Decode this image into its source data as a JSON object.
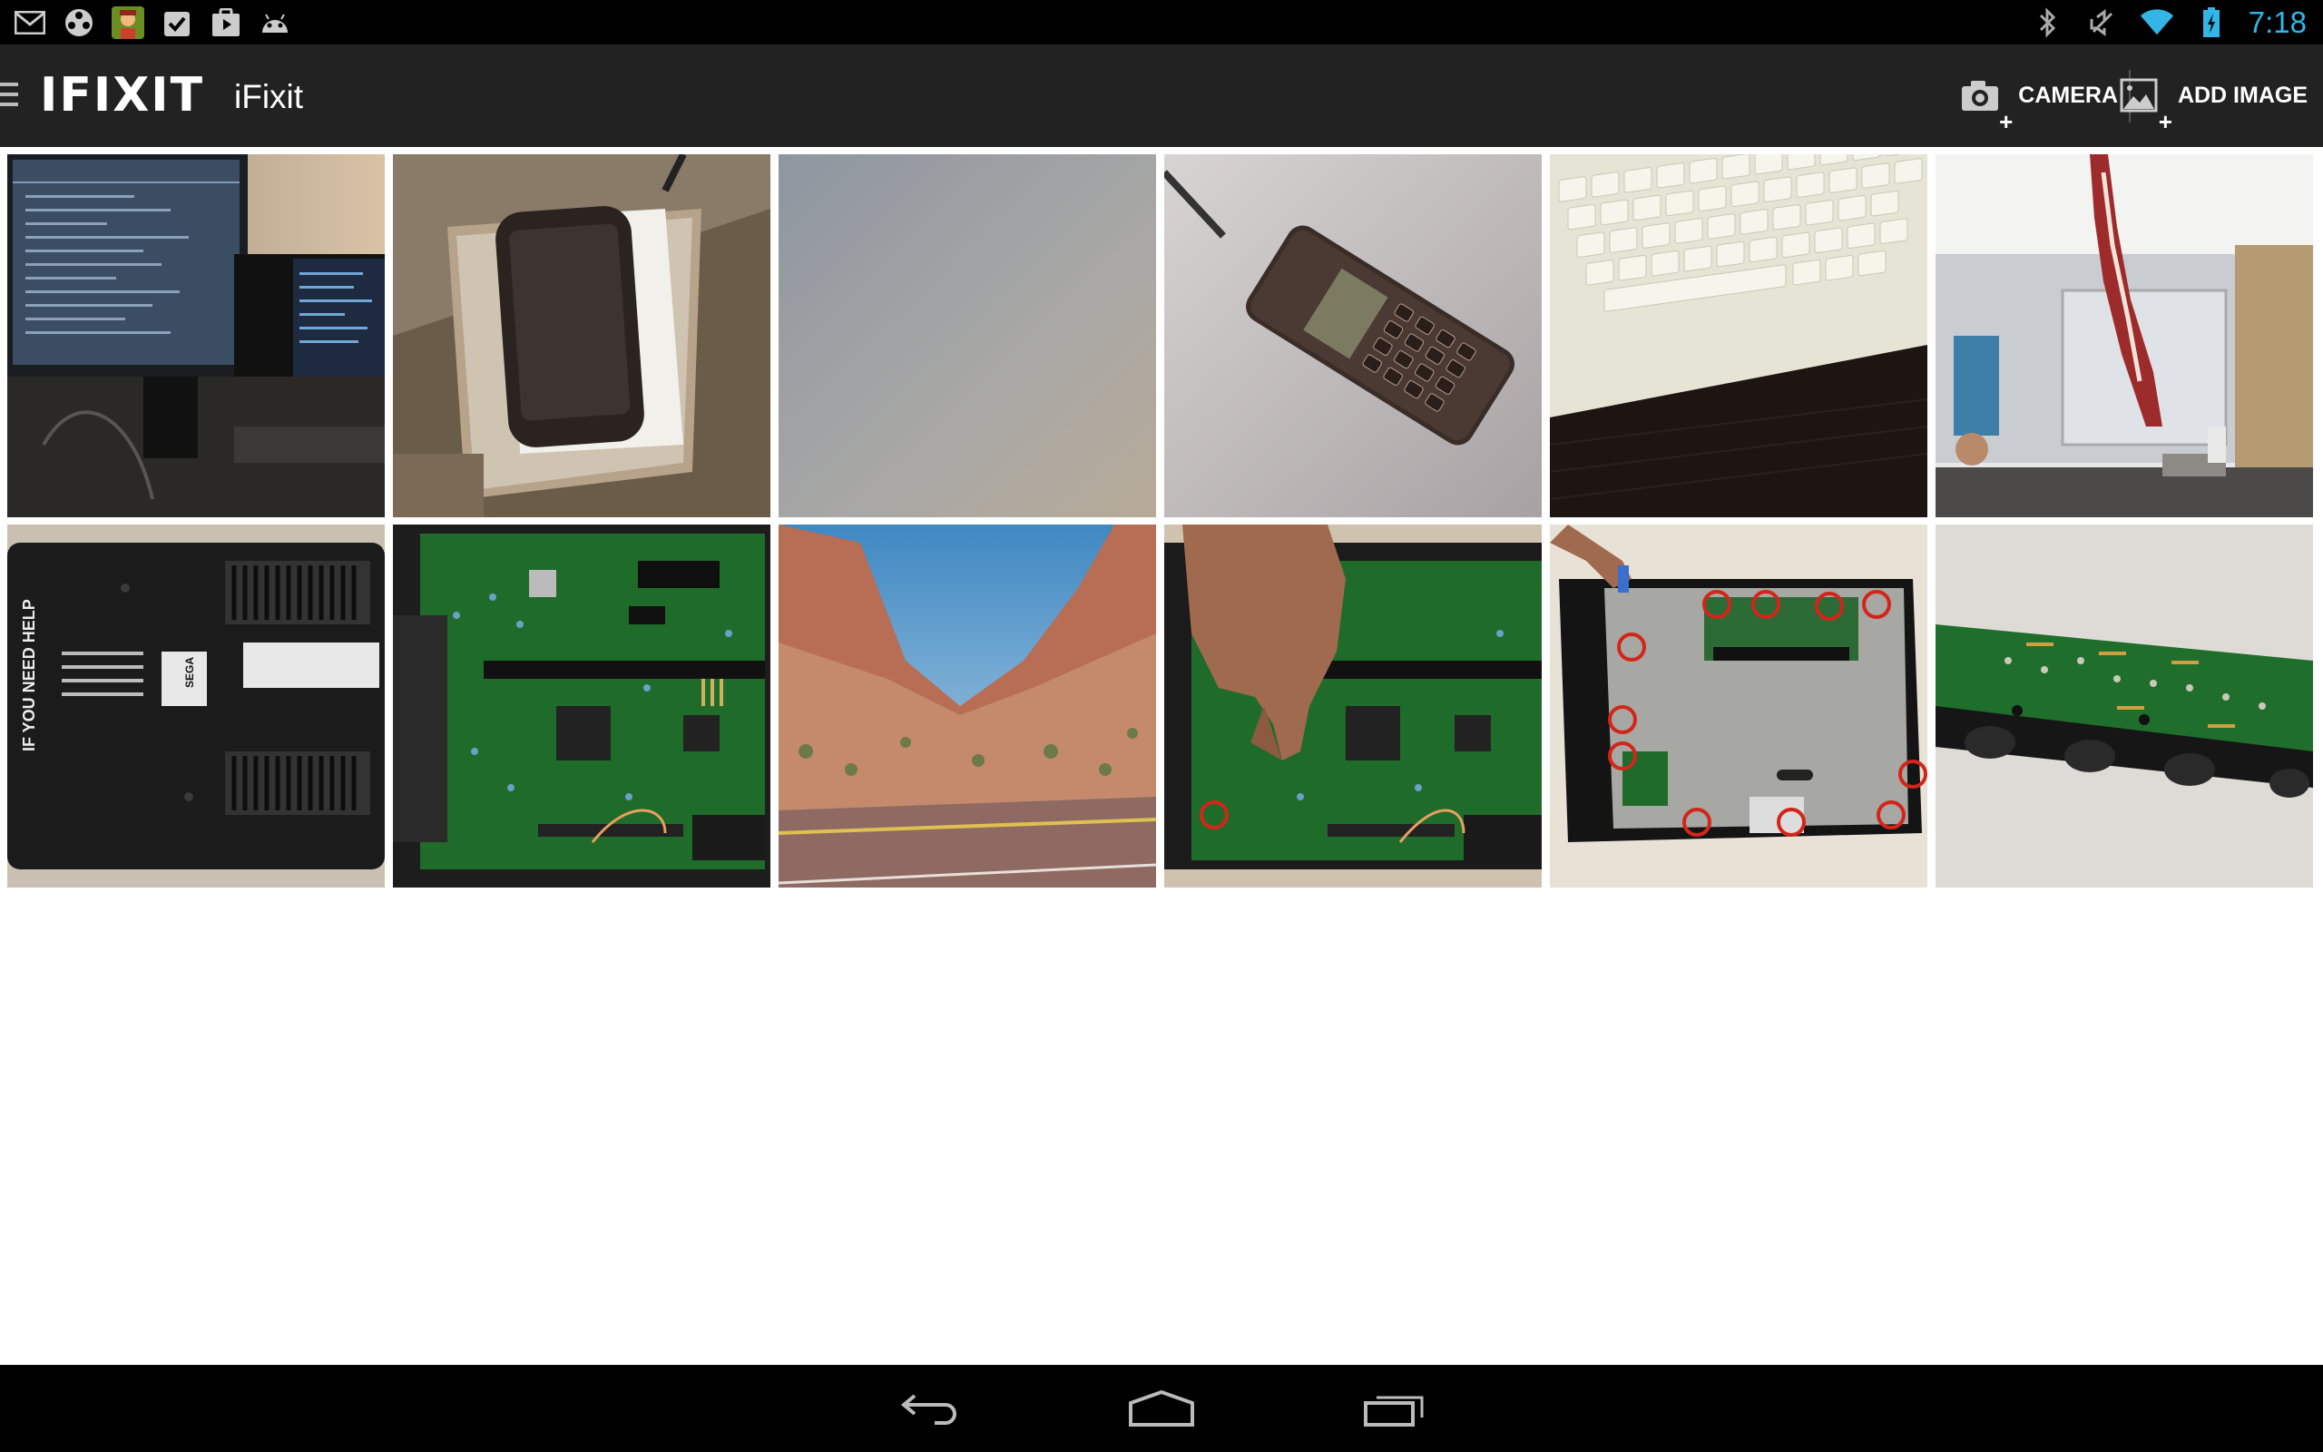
{
  "status_bar": {
    "time": "7:18",
    "left_icons": [
      "gmail-icon",
      "media-reel-icon",
      "game-avatar-icon",
      "task-check-icon",
      "play-store-icon",
      "android-icon"
    ],
    "right_icons": [
      "bluetooth-icon",
      "muted-icon",
      "wifi-icon",
      "battery-charging-icon"
    ],
    "accent_color": "#33b5e5"
  },
  "action_bar": {
    "logo_text": "IFIXIT",
    "title": "iFixit",
    "camera_label": "CAMERA",
    "add_image_label": "ADD IMAGE",
    "background_color": "#222222"
  },
  "gallery": {
    "images": [
      {
        "name": "computer-monitors-photo",
        "subject": "monitors"
      },
      {
        "name": "phone-in-case-photo",
        "subject": "phone"
      },
      {
        "name": "blank-gray-photo",
        "subject": "blank"
      },
      {
        "name": "old-cell-phone-photo",
        "subject": "cellphone"
      },
      {
        "name": "keyboard-photo",
        "subject": "keyboard"
      },
      {
        "name": "office-sculpture-photo",
        "subject": "office"
      },
      {
        "name": "sega-console-bottom-photo",
        "subject": "console-bottom"
      },
      {
        "name": "circuit-board-photo",
        "subject": "pcb"
      },
      {
        "name": "canyon-road-photo",
        "subject": "canyon"
      },
      {
        "name": "hand-on-circuit-board-photo",
        "subject": "pcb-hand"
      },
      {
        "name": "metal-shield-screws-photo",
        "subject": "shield"
      },
      {
        "name": "pcb-strip-photo",
        "subject": "pcb-strip"
      }
    ]
  },
  "nav_bar": {
    "buttons": [
      "back-icon",
      "home-icon",
      "recent-apps-icon"
    ]
  },
  "tile_label_texts": {
    "sega_warning": "IF YOU NEED HELP",
    "sega_brand": "SEGA"
  }
}
